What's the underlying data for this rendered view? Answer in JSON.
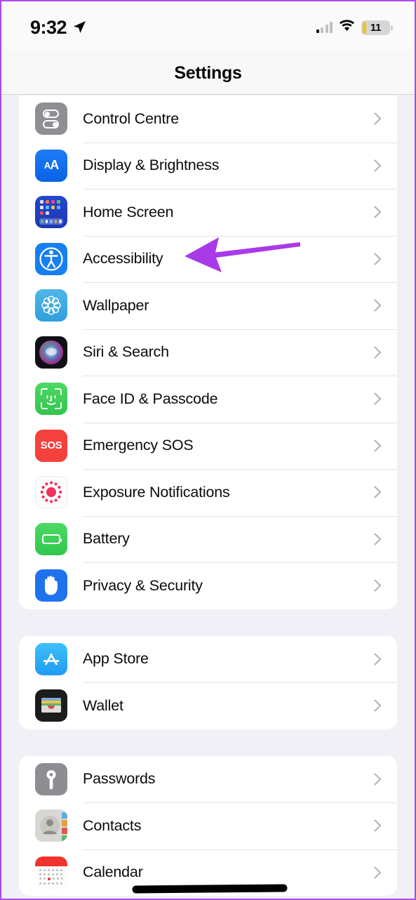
{
  "status_bar": {
    "time": "9:32",
    "location_icon": "location-arrow-icon",
    "signal_icon": "cellular-signal-icon",
    "wifi_icon": "wifi-icon",
    "battery_percent": "11",
    "battery_low_power_color": "#f0c419"
  },
  "nav": {
    "title": "Settings"
  },
  "annotation": {
    "arrow_color": "#a93ae8",
    "arrow_points_to": "Accessibility",
    "redaction_color": "#000000"
  },
  "theme": {
    "page_background": "#f2f0f7",
    "card_background": "#ffffff",
    "label_color": "#0b0b0b",
    "chevron_color": "#b5b5ba",
    "border_color": "#ab4af0"
  },
  "sections": [
    {
      "id": "system-section",
      "rows": [
        {
          "label": "Control Centre",
          "icon": "control-centre-icon"
        },
        {
          "label": "Display & Brightness",
          "icon": "display-brightness-icon"
        },
        {
          "label": "Home Screen",
          "icon": "home-screen-icon"
        },
        {
          "label": "Accessibility",
          "icon": "accessibility-icon"
        },
        {
          "label": "Wallpaper",
          "icon": "wallpaper-icon"
        },
        {
          "label": "Siri & Search",
          "icon": "siri-icon"
        },
        {
          "label": "Face ID & Passcode",
          "icon": "face-id-icon"
        },
        {
          "label": "Emergency SOS",
          "icon": "emergency-sos-icon"
        },
        {
          "label": "Exposure Notifications",
          "icon": "exposure-notifications-icon"
        },
        {
          "label": "Battery",
          "icon": "battery-icon"
        },
        {
          "label": "Privacy & Security",
          "icon": "privacy-security-icon"
        }
      ]
    },
    {
      "id": "store-section",
      "rows": [
        {
          "label": "App Store",
          "icon": "app-store-icon"
        },
        {
          "label": "Wallet",
          "icon": "wallet-icon"
        }
      ]
    },
    {
      "id": "accounts-section",
      "rows": [
        {
          "label": "Passwords",
          "icon": "passwords-icon"
        },
        {
          "label": "Contacts",
          "icon": "contacts-icon"
        },
        {
          "label": "Calendar",
          "icon": "calendar-icon"
        }
      ]
    }
  ],
  "sos_text": "SOS",
  "display_icon_text": {
    "big": "A",
    "small": "A"
  }
}
